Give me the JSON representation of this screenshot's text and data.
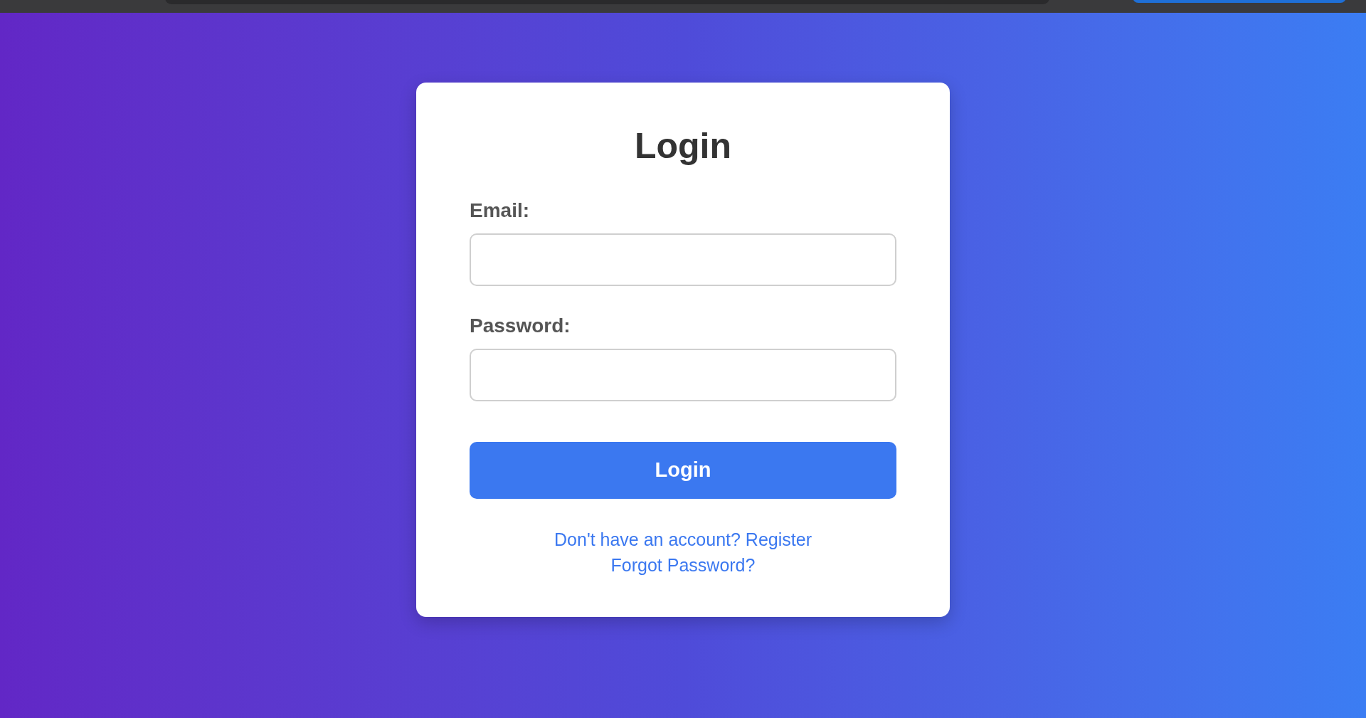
{
  "form": {
    "title": "Login",
    "fields": [
      {
        "label": "Email:"
      },
      {
        "label": "Password:"
      }
    ],
    "submit": "Login",
    "links": [
      {
        "text": "Don't have an account? Register"
      },
      {
        "text": "Forgot Password?"
      }
    ]
  }
}
